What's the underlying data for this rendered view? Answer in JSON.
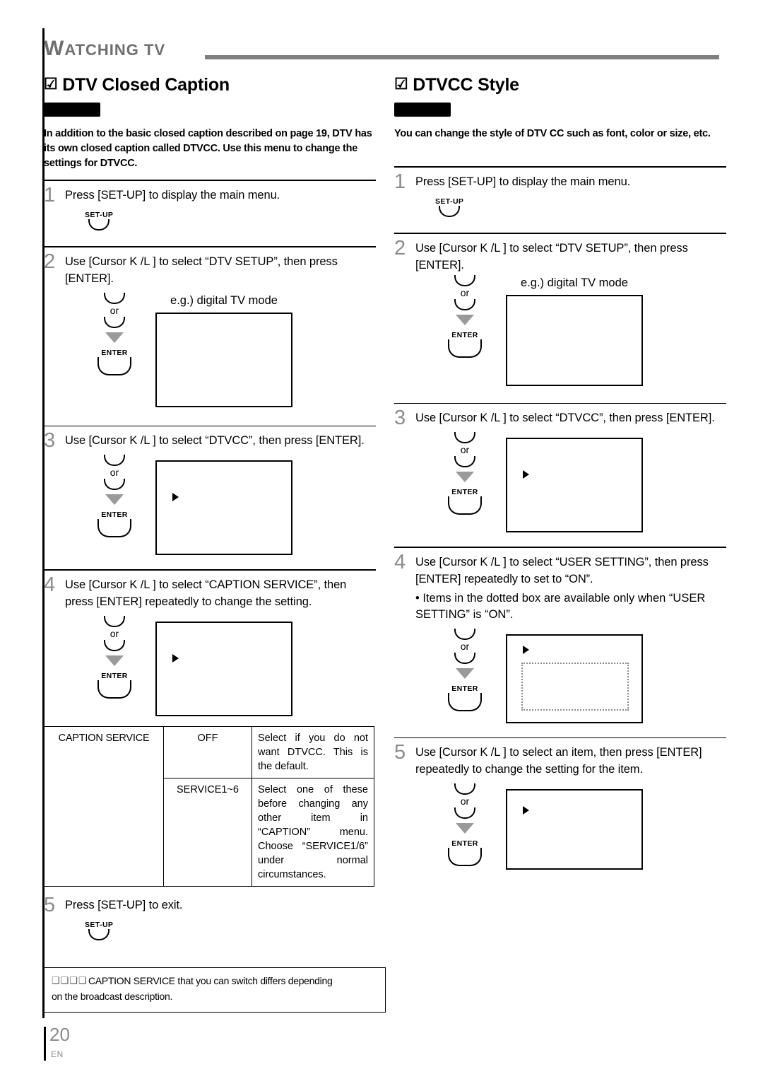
{
  "header": {
    "chapter_cap": "W",
    "chapter_rest": "ATCHING TV"
  },
  "left": {
    "marker": "☑",
    "title": "DTV Closed Caption",
    "intro": "In addition to the basic closed caption described on page 19, DTV has its own closed caption called DTVCC. Use this menu to change the settings for DTVCC.",
    "steps": [
      {
        "num": "1",
        "text": "Press [SET-UP] to display the main menu.",
        "key": "SET-UP"
      },
      {
        "num": "2",
        "text": "Use [Cursor K /L ] to select “DTV SETUP”, then press [ENTER].",
        "or": "or",
        "key": "ENTER",
        "caption": "e.g.) digital TV mode"
      },
      {
        "num": "3",
        "text": "Use [Cursor K /L ] to select “DTVCC”, then press [ENTER].",
        "or": "or",
        "key": "ENTER"
      },
      {
        "num": "4",
        "text": "Use [Cursor K /L ] to select “CAPTION SERVICE”, then press [ENTER] repeatedly to change the setting.",
        "or": "or",
        "key": "ENTER"
      },
      {
        "num": "5",
        "text": "Press [SET-UP] to exit.",
        "key": "SET-UP"
      }
    ],
    "table": {
      "row_label": "CAPTION SERVICE",
      "rows": [
        {
          "value": "OFF",
          "desc": "Select if you do not want DTVCC. This is the default."
        },
        {
          "value": "SERVICE1~6",
          "desc": "Select one of these before changing any other item in “CAPTION” menu. Choose “SERVICE1/6” under normal circumstances."
        }
      ]
    },
    "note": {
      "mark": "❑❑❑❑",
      "line1": "CAPTION SERVICE that you can switch differs depending",
      "line2": "on the broadcast description."
    }
  },
  "right": {
    "marker": "☑",
    "title": "DTVCC Style",
    "intro": "You can change the style of DTV CC such as font, color or size, etc.",
    "steps": [
      {
        "num": "1",
        "text": "Press [SET-UP] to display the main menu.",
        "key": "SET-UP"
      },
      {
        "num": "2",
        "text": "Use [Cursor K /L ] to select “DTV SETUP”, then press [ENTER].",
        "or": "or",
        "key": "ENTER",
        "caption": "e.g.) digital TV mode"
      },
      {
        "num": "3",
        "text": "Use [Cursor K /L ] to select “DTVCC”, then press [ENTER].",
        "or": "or",
        "key": "ENTER"
      },
      {
        "num": "4",
        "text": "Use [Cursor K /L ] to select “USER SETTING”, then press [ENTER] repeatedly to set to “ON”.",
        "bullet": "• Items in the dotted box are available only when “USER SETTING” is “ON”.",
        "or": "or",
        "key": "ENTER"
      },
      {
        "num": "5",
        "text": "Use [Cursor K /L ] to select an item, then press [ENTER] repeatedly to change the setting for the item.",
        "or": "or",
        "key": "ENTER"
      }
    ]
  },
  "footer": {
    "page_number": "20",
    "language": "EN"
  }
}
